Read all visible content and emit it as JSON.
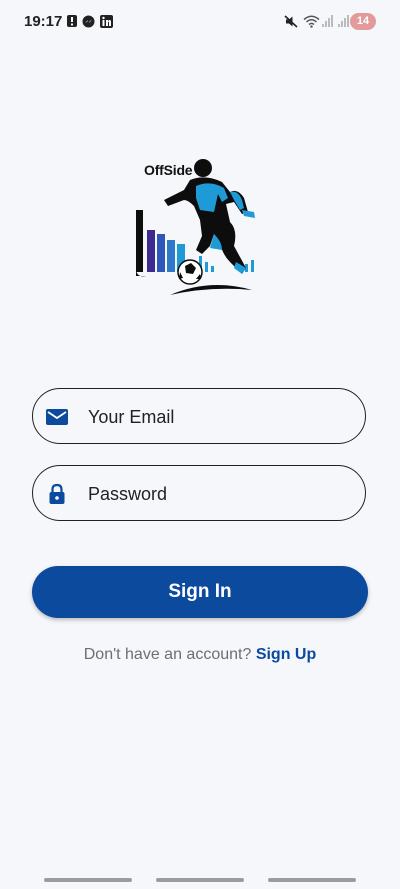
{
  "status_bar": {
    "time": "19:17",
    "battery": "14"
  },
  "logo": {
    "text": "OffSide"
  },
  "login_form": {
    "email_placeholder": "Your Email",
    "password_placeholder": "Password",
    "sign_in_label": "Sign In",
    "signup_prompt": "Don't have an account?",
    "signup_link": "Sign Up"
  },
  "colors": {
    "primary": "#0c4a9e",
    "background": "#f6f7fb",
    "accent_blue": "#1e9ad6"
  }
}
